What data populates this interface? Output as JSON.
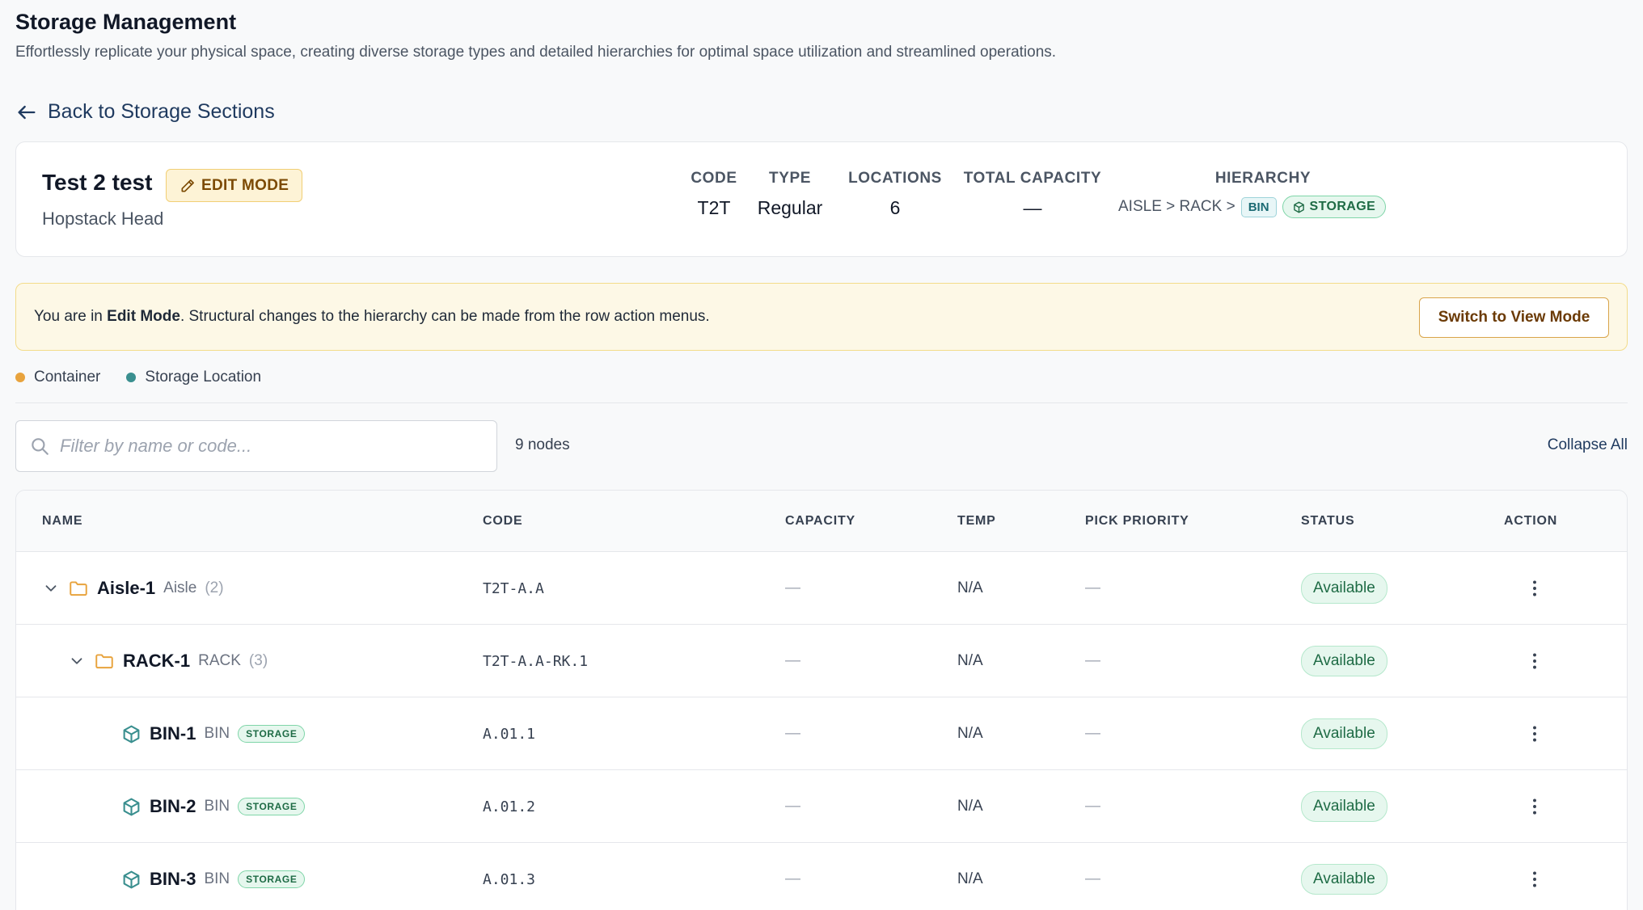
{
  "header": {
    "title": "Storage Management",
    "subtitle": "Effortlessly replicate your physical space, creating diverse storage types and detailed hierarchies for optimal space utilization and streamlined operations.",
    "back_label": "Back to Storage Sections"
  },
  "section": {
    "name": "Test 2 test",
    "mode_badge": "EDIT MODE",
    "warehouse": "Hopstack Head",
    "stats": {
      "code_label": "CODE",
      "code_value": "T2T",
      "type_label": "TYPE",
      "type_value": "Regular",
      "locations_label": "LOCATIONS",
      "locations_value": "6",
      "capacity_label": "TOTAL CAPACITY",
      "capacity_value": "—",
      "hierarchy_label": "HIERARCHY",
      "hierarchy_path": "AISLE > RACK >",
      "hierarchy_bin": "BIN",
      "hierarchy_storage": "STORAGE"
    }
  },
  "banner": {
    "prefix": "You are in ",
    "bold": "Edit Mode",
    "suffix": ". Structural changes to the hierarchy can be made from the row action menus.",
    "button_label": "Switch to View Mode"
  },
  "legend": {
    "container": {
      "label": "Container",
      "color": "#e8a33d"
    },
    "storage": {
      "label": "Storage Location",
      "color": "#3a8f8f"
    }
  },
  "toolbar": {
    "search_placeholder": "Filter by name or code...",
    "node_count": "9 nodes",
    "collapse_all": "Collapse All"
  },
  "table": {
    "columns": [
      "NAME",
      "CODE",
      "CAPACITY",
      "TEMP",
      "PICK PRIORITY",
      "STATUS",
      "ACTION"
    ],
    "rows": [
      {
        "name": "Aisle-1",
        "type": "Aisle",
        "count": "(2)",
        "code": "T2T-A.A",
        "capacity": "—",
        "temp": "N/A",
        "pick_priority": "—",
        "status": "Available"
      },
      {
        "name": "RACK-1",
        "type": "RACK",
        "count": "(3)",
        "code": "T2T-A.A-RK.1",
        "capacity": "—",
        "temp": "N/A",
        "pick_priority": "—",
        "status": "Available"
      },
      {
        "name": "BIN-1",
        "type": "BIN",
        "tag": "STORAGE",
        "code": "A.01.1",
        "capacity": "—",
        "temp": "N/A",
        "pick_priority": "—",
        "status": "Available"
      },
      {
        "name": "BIN-2",
        "type": "BIN",
        "tag": "STORAGE",
        "code": "A.01.2",
        "capacity": "—",
        "temp": "N/A",
        "pick_priority": "—",
        "status": "Available"
      },
      {
        "name": "BIN-3",
        "type": "BIN",
        "tag": "STORAGE",
        "code": "A.01.3",
        "capacity": "—",
        "temp": "N/A",
        "pick_priority": "—",
        "status": "Available"
      }
    ]
  },
  "icons": {
    "back": "arrow-left-icon",
    "edit": "pencil-icon",
    "storage": "cube-icon",
    "search": "search-icon",
    "expand": "chevron-down-icon",
    "container": "folder-icon",
    "action": "kebab-menu-icon"
  }
}
